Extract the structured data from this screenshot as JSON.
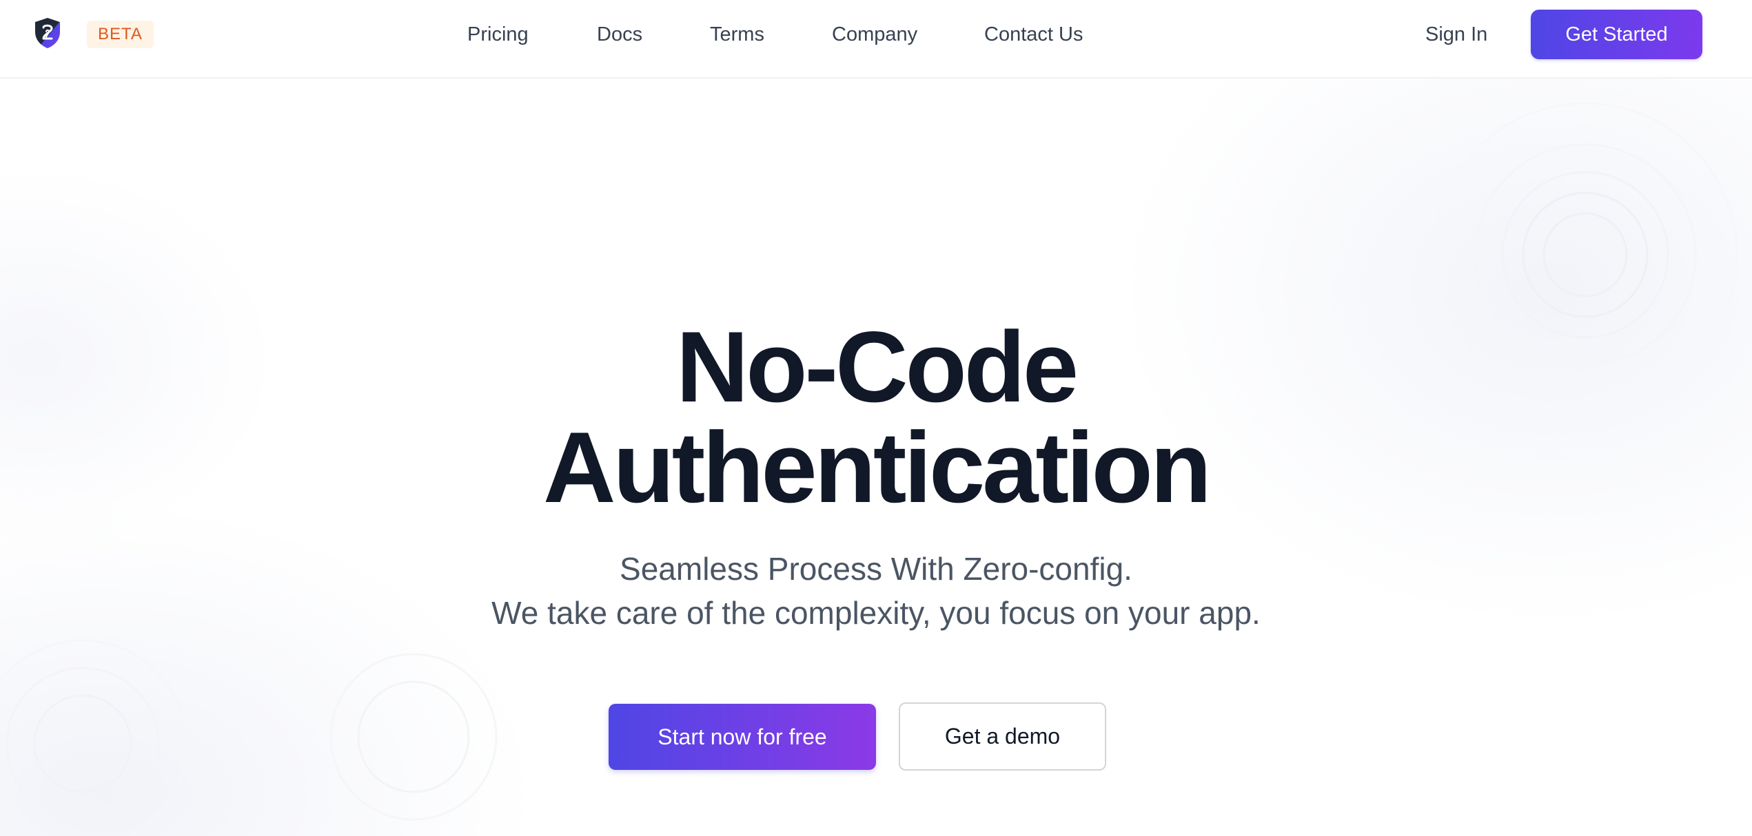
{
  "navbar": {
    "badge": "BETA",
    "links": [
      {
        "label": "Pricing"
      },
      {
        "label": "Docs"
      },
      {
        "label": "Terms"
      },
      {
        "label": "Company"
      },
      {
        "label": "Contact Us"
      }
    ],
    "sign_in": "Sign In",
    "get_started": "Get Started"
  },
  "hero": {
    "title_line1": "No-Code",
    "title_line2": "Authentication",
    "subtitle_line1": "Seamless Process With Zero-config.",
    "subtitle_line2": "We take care of the complexity, you focus on your app.",
    "primary_cta": "Start now for free",
    "secondary_cta": "Get a demo"
  },
  "colors": {
    "accent_start": "#4f46e5",
    "accent_end": "#8b3ae6",
    "badge_bg": "#fff3e6",
    "badge_text": "#dd5a1c",
    "heading": "#111827",
    "body_text": "#4b5563"
  },
  "icons": {
    "logo": "shield-logo-icon"
  }
}
